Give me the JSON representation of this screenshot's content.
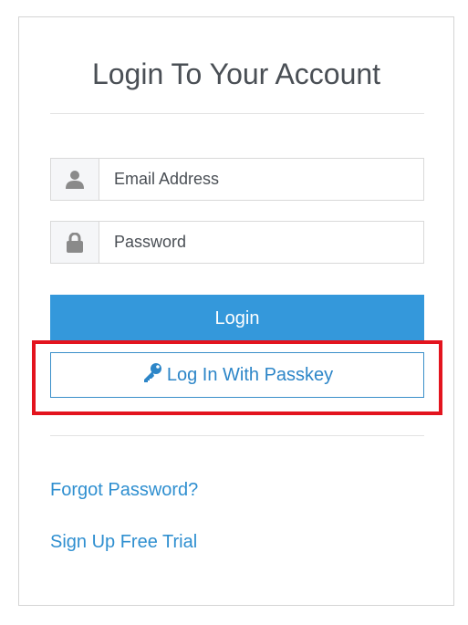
{
  "login_card": {
    "title": "Login To Your Account",
    "email": {
      "placeholder": "Email Address",
      "value": ""
    },
    "password": {
      "placeholder": "Password",
      "value": ""
    },
    "login_button": "Login",
    "passkey_button": "Log In With Passkey",
    "forgot_password_link": "Forgot Password?",
    "signup_link": "Sign Up Free Trial"
  },
  "icons": {
    "email": "user-icon",
    "password": "lock-icon",
    "passkey": "key-icon"
  },
  "colors": {
    "primary": "#3498db",
    "link": "#2f8fd0",
    "highlight": "#e3141e",
    "title_text": "#4a4f55",
    "addon_bg": "#f5f6f8",
    "addon_icon": "#8a8a8a"
  }
}
